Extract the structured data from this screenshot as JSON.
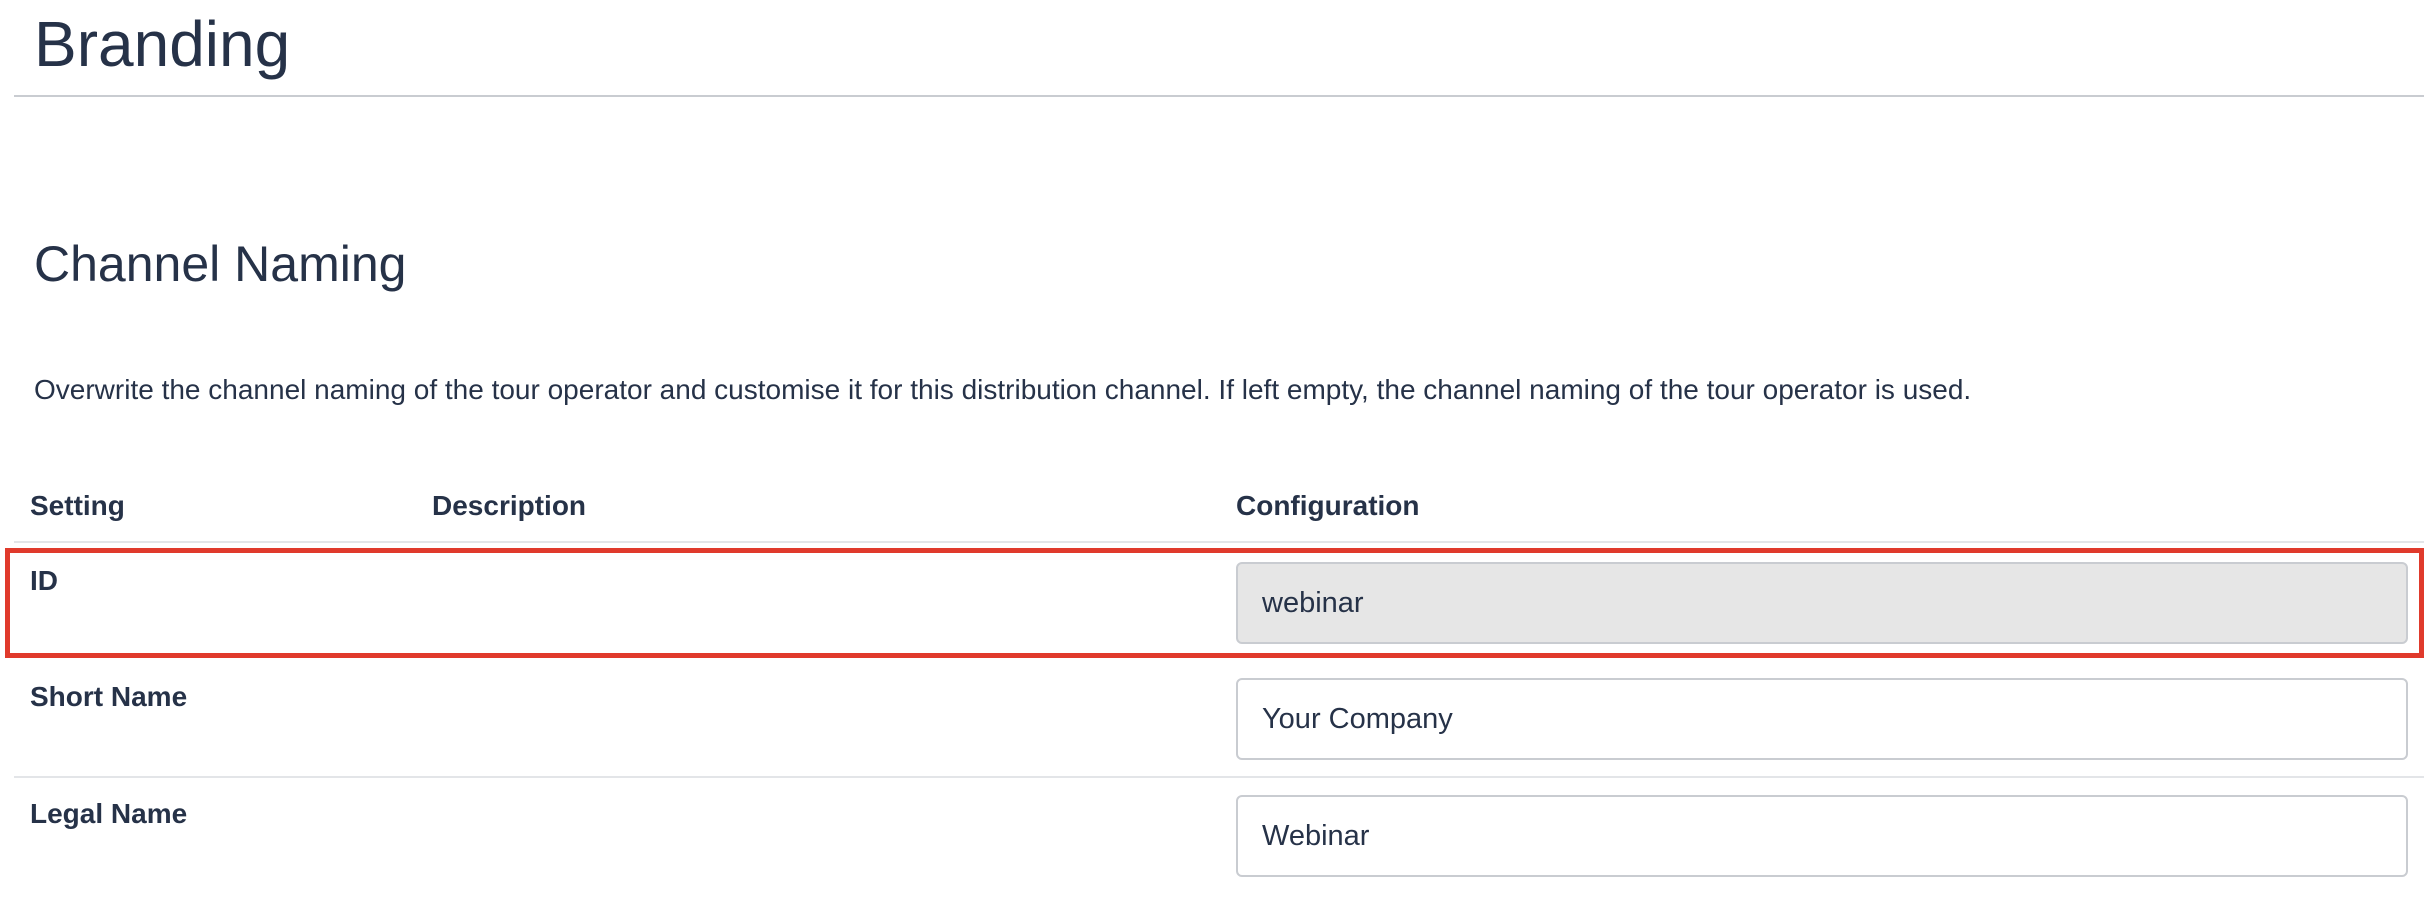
{
  "page": {
    "title": "Branding"
  },
  "section": {
    "title": "Channel Naming",
    "description": "Overwrite the channel naming of the tour operator and customise it for this distribution channel. If left empty, the channel naming of the tour operator is used."
  },
  "table": {
    "headers": {
      "setting": "Setting",
      "description": "Description",
      "configuration": "Configuration"
    },
    "rows": [
      {
        "label": "ID",
        "value": "webinar",
        "readonly": true
      },
      {
        "label": "Short Name",
        "value": "Your Company",
        "readonly": false
      },
      {
        "label": "Legal Name",
        "value": "Webinar",
        "readonly": false
      }
    ]
  },
  "colors": {
    "text": "#263248",
    "highlight": "#e03a2c",
    "readonly_field": "#e6e6e6",
    "border": "#c9ccd1"
  }
}
